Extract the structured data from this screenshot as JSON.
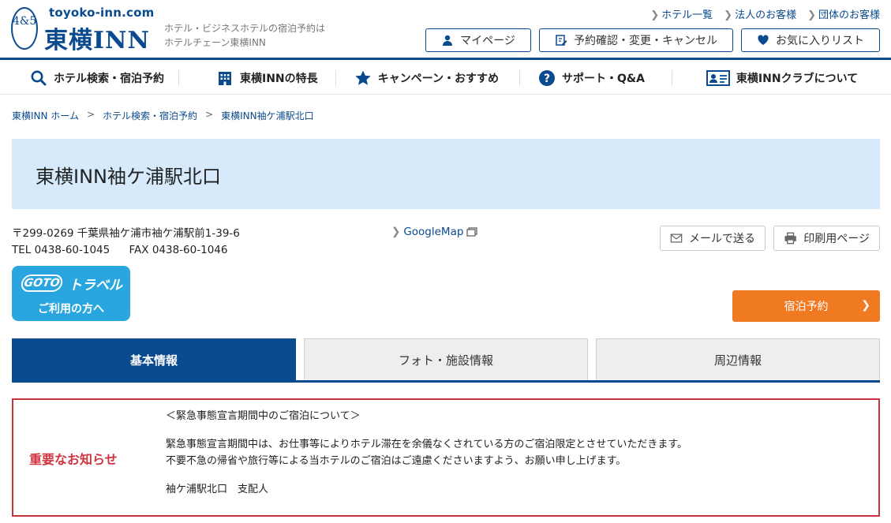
{
  "header": {
    "logo": {
      "domain": "toyoko-inn.com",
      "name": "東横INN",
      "mark": "4&5"
    },
    "tagline": [
      "ホテル・ビジネスホテルの宿泊予約は",
      "ホテルチェーン東横INN"
    ],
    "toplinks": [
      "ホテル一覧",
      "法人のお客様",
      "団体のお客様"
    ],
    "buttons": {
      "mypage": "マイページ",
      "reservation": "予約確認・変更・キャンセル",
      "favorites": "お気に入りリスト"
    }
  },
  "nav": {
    "search": "ホテル検索・宿泊予約",
    "features": "東横INNの特長",
    "campaign": "キャンペーン・おすすめ",
    "support": "サポート・Q&A",
    "club": "東横INNクラブについて"
  },
  "breadcrumb": [
    "東横INN ホーム",
    "ホテル検索・宿泊予約",
    "東横INN袖ケ浦駅北口"
  ],
  "hotel": {
    "title": "東横INN袖ケ浦駅北口",
    "postal": "〒299-0269",
    "address": "千葉県袖ケ浦市袖ケ浦駅前1-39-6",
    "tel": "TEL 0438-60-1045",
    "fax": "FAX 0438-60-1046",
    "googlemap": "GoogleMap"
  },
  "actions": {
    "mail": "メールで送る",
    "print": "印刷用ページ",
    "reserve": "宿泊予約"
  },
  "goto": {
    "badge": "GOTO",
    "title": "トラベル",
    "subtitle": "ご利用の方へ"
  },
  "tabs": [
    "基本情報",
    "フォト・施設情報",
    "周辺情報"
  ],
  "notice": {
    "label": "重要なお知らせ",
    "heading": "＜緊急事態宣言期間中のご宿泊について＞",
    "line1": "緊急事態宣言期間中は、お仕事等によりホテル滞在を余儀なくされている方のご宿泊限定とさせていただきます。",
    "line2": "不要不急の帰省や旅行等による当ホテルのご宿泊はご遠慮くださいますよう、お願い申し上げます。",
    "signature": "袖ケ浦駅北口　支配人"
  },
  "colors": {
    "brand": "#0a4a8e",
    "accent": "#ef7a22",
    "notice": "#c9353f",
    "band": "#d6eafc"
  }
}
